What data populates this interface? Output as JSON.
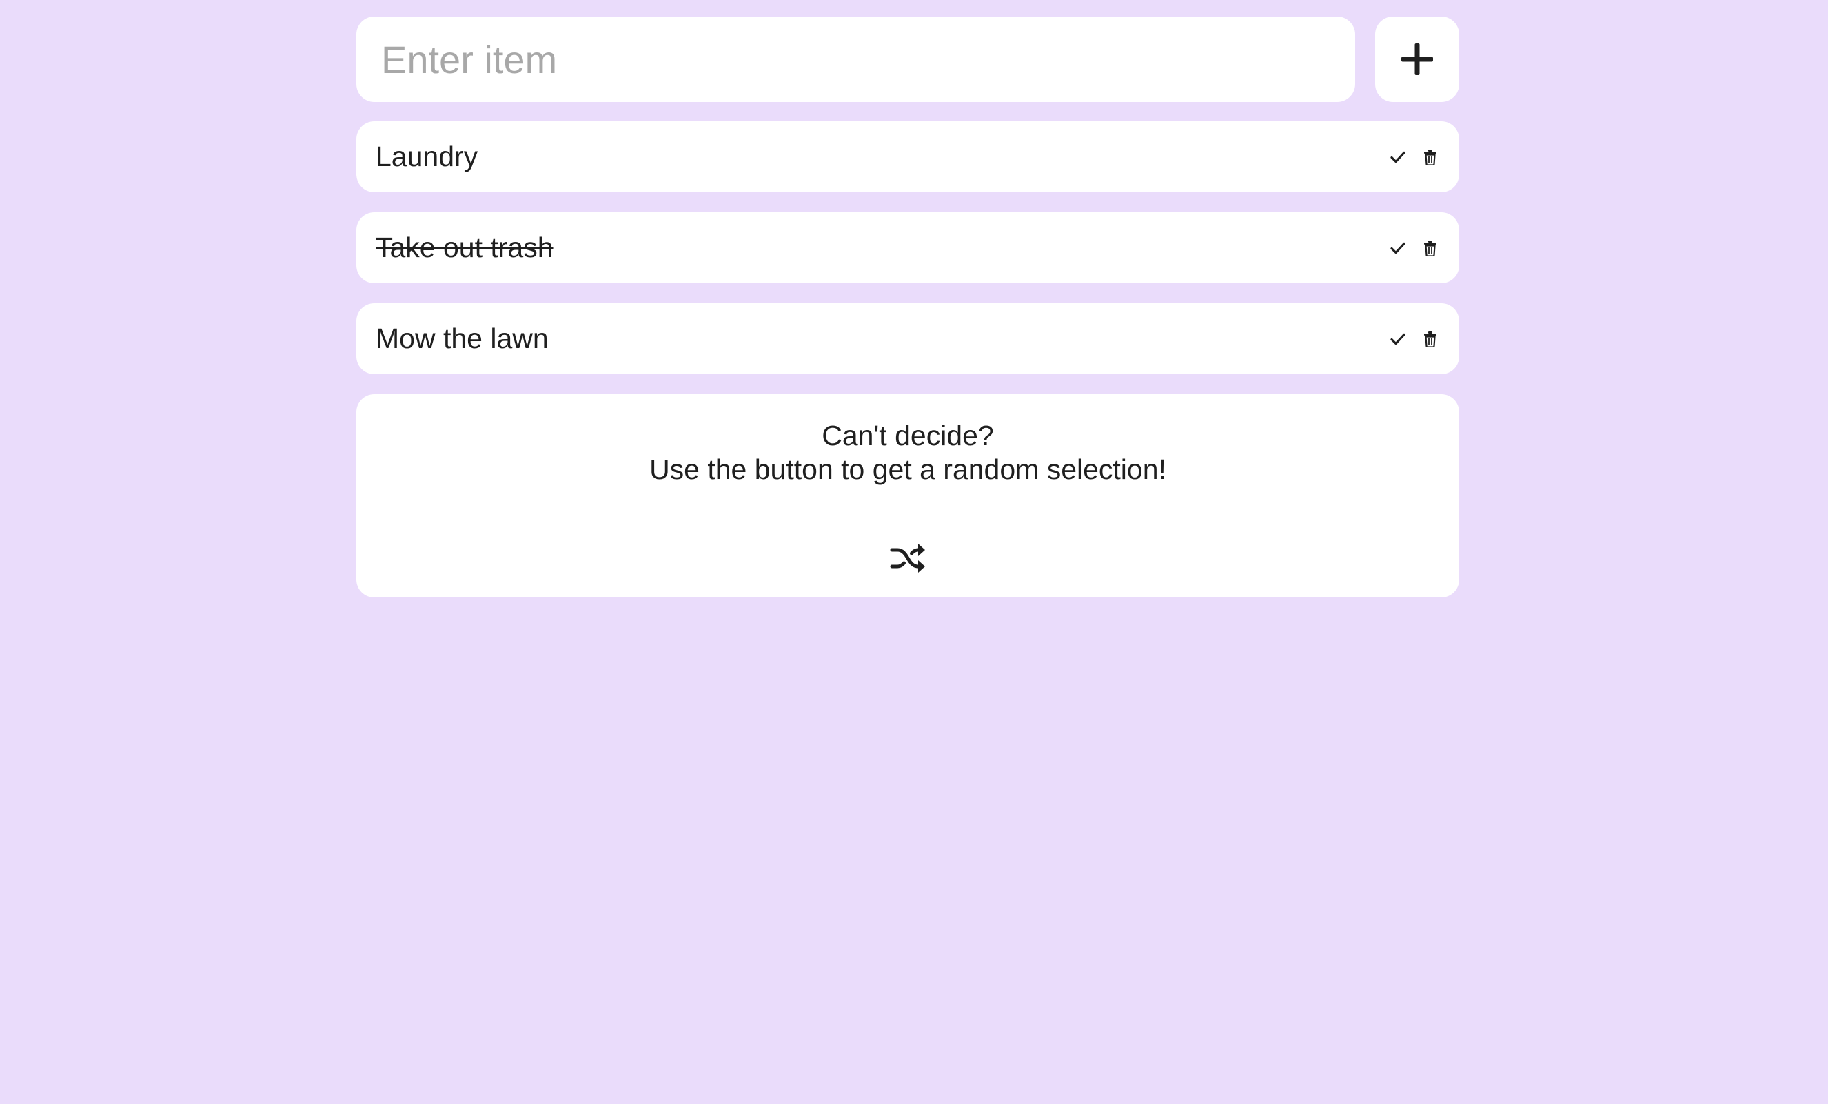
{
  "input": {
    "placeholder": "Enter item",
    "value": ""
  },
  "add_button": {
    "icon": "plus-icon"
  },
  "todos": [
    {
      "text": "Laundry",
      "done": false
    },
    {
      "text": "Take out trash",
      "done": true
    },
    {
      "text": "Mow the lawn",
      "done": false
    }
  ],
  "item_actions": {
    "complete_icon": "check-icon",
    "delete_icon": "trash-icon"
  },
  "random": {
    "line1": "Can't decide?",
    "line2": "Use the button to get a random selection!",
    "icon": "shuffle-icon"
  },
  "colors": {
    "background": "#eadcfb",
    "card": "#ffffff",
    "text": "#1f1f1f",
    "placeholder": "#a8a8a8"
  }
}
